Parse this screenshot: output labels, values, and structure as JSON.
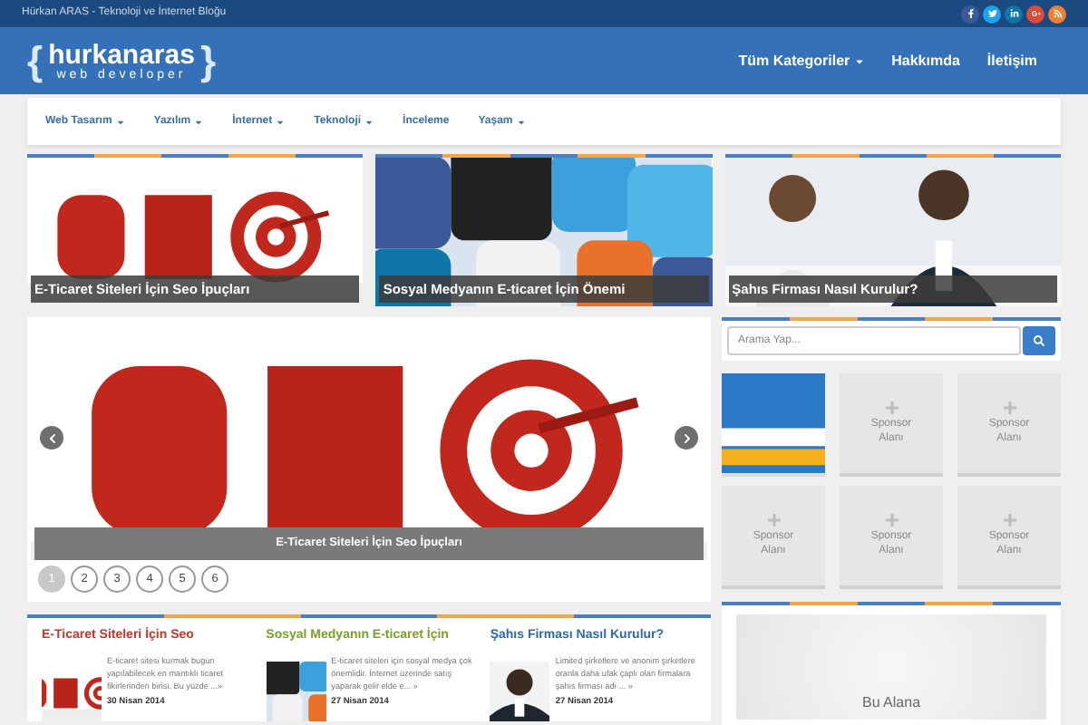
{
  "topbar": {
    "tagline": "Hürkan ARAS - Teknoloji ve İnternet Bloğu",
    "social": [
      {
        "kind": "facebook",
        "color": "#3b5998"
      },
      {
        "kind": "twitter",
        "color": "#1da1f2"
      },
      {
        "kind": "linkedin",
        "color": "#0e76a8"
      },
      {
        "kind": "googleplus",
        "color": "#dd4b39"
      },
      {
        "kind": "rss",
        "color": "#ee802f"
      }
    ]
  },
  "logo": {
    "brace_open": "{",
    "name": "hurkanaras",
    "subtitle": "web developer",
    "brace_close": "}"
  },
  "main_nav": [
    {
      "label": "Tüm Kategoriler",
      "dropdown": true
    },
    {
      "label": "Hakkımda",
      "dropdown": false
    },
    {
      "label": "İletişim",
      "dropdown": false
    }
  ],
  "category_nav": [
    {
      "label": "Web Tasarım",
      "dropdown": true
    },
    {
      "label": "Yazılım",
      "dropdown": true
    },
    {
      "label": "İnternet",
      "dropdown": true
    },
    {
      "label": "Teknoloji",
      "dropdown": true
    },
    {
      "label": "İnceleme",
      "dropdown": false
    },
    {
      "label": "Yaşam",
      "dropdown": true
    }
  ],
  "featured": [
    {
      "caption": "E-Ticaret Siteleri İçin Seo İpuçları",
      "kind": "seo"
    },
    {
      "caption": "Sosyal Medyanın E-ticaret İçin Önemi",
      "kind": "social"
    },
    {
      "caption": "Şahıs Firması Nasıl Kurulur?",
      "kind": "office"
    }
  ],
  "slider": {
    "caption": "E-Ticaret Siteleri İçin Seo İpuçları",
    "kind": "seo",
    "pages": [
      {
        "label": "1",
        "selected": true
      },
      {
        "label": "2",
        "selected": false
      },
      {
        "label": "3",
        "selected": false
      },
      {
        "label": "4",
        "selected": false
      },
      {
        "label": "5",
        "selected": false
      },
      {
        "label": "6",
        "selected": false
      }
    ]
  },
  "search": {
    "placeholder": "Arama Yap..."
  },
  "sponsors": [
    {
      "kind": "picture"
    },
    {
      "kind": "sponsor",
      "label": "Sponsor Alanı"
    },
    {
      "kind": "sponsor",
      "label": "Sponsor Alanı"
    },
    {
      "kind": "sponsor",
      "label": "Sponsor Alanı"
    },
    {
      "kind": "sponsor",
      "label": "Sponsor Alanı"
    },
    {
      "kind": "sponsor",
      "label": "Sponsor Alanı"
    }
  ],
  "ad": {
    "text": "Bu Alana"
  },
  "posts": [
    {
      "title": "E-Ticaret Siteleri İçin Seo",
      "color": "#c0392b",
      "kind": "seo",
      "excerpt": "E-ticaret sitesi kurmak bugün yapılabilecek en mantıklı ticaret fikirlerinden birisi. Bu yüzde ...»",
      "date": "30 Nisan 2014"
    },
    {
      "title": "Sosyal Medyanın E-ticaret İçin",
      "color": "#7aa22b",
      "kind": "social",
      "excerpt": "E-ticaret siteleri için sosyal medya çok önemlidir. İnternet üzerinde satış yaparak gelir elde e... »",
      "date": "27 Nisan 2014"
    },
    {
      "title": "Şahıs Firması Nasıl Kurulur?",
      "color": "#2e6aa6",
      "kind": "portrait",
      "excerpt": "Limited şirketlere ve anonim şirketlere oranla daha ufak çaplı olan firmalara şahıs firması adı ... »",
      "date": "27 Nisan 2014"
    }
  ]
}
